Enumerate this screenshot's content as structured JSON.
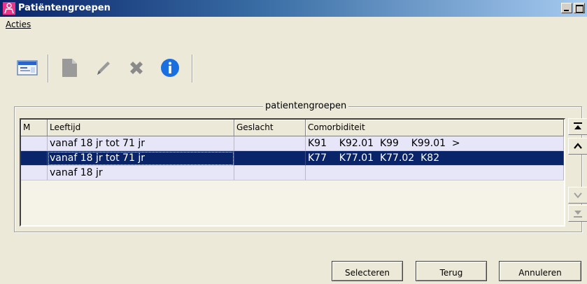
{
  "window": {
    "title": "Patiëntengroepen"
  },
  "menu": {
    "acties": "Acties"
  },
  "toolbar": {
    "items": [
      {
        "name": "patient-card-icon",
        "enabled": true
      },
      {
        "name": "new-document-icon",
        "enabled": false
      },
      {
        "name": "pencil-edit-icon",
        "enabled": false
      },
      {
        "name": "delete-cross-icon",
        "enabled": false
      },
      {
        "name": "info-icon",
        "enabled": true
      }
    ]
  },
  "group": {
    "legend": "patientengroepen",
    "columns": [
      "M",
      "Leeftijd",
      "Geslacht",
      "Comorbiditeit"
    ],
    "rows": [
      {
        "m": "",
        "leeftijd": "vanaf 18 jr tot 71 jr",
        "geslacht": "",
        "comorbiditeit": "K91    K92.01  K99    K99.01  >",
        "selected": false
      },
      {
        "m": "",
        "leeftijd": "vanaf 18 jr tot 71 jr",
        "geslacht": "",
        "comorbiditeit": "K77    K77.01  K77.02  K82",
        "selected": true
      },
      {
        "m": "",
        "leeftijd": "vanaf 18 jr",
        "geslacht": "",
        "comorbiditeit": "",
        "selected": false
      }
    ]
  },
  "buttons": {
    "selecteren": "Selecteren",
    "terug": "Terug",
    "annuleren": "Annuleren"
  },
  "colors": {
    "selection": "#0a246a",
    "title_start": "#0a246a",
    "info_blue": "#1a6fe0"
  }
}
